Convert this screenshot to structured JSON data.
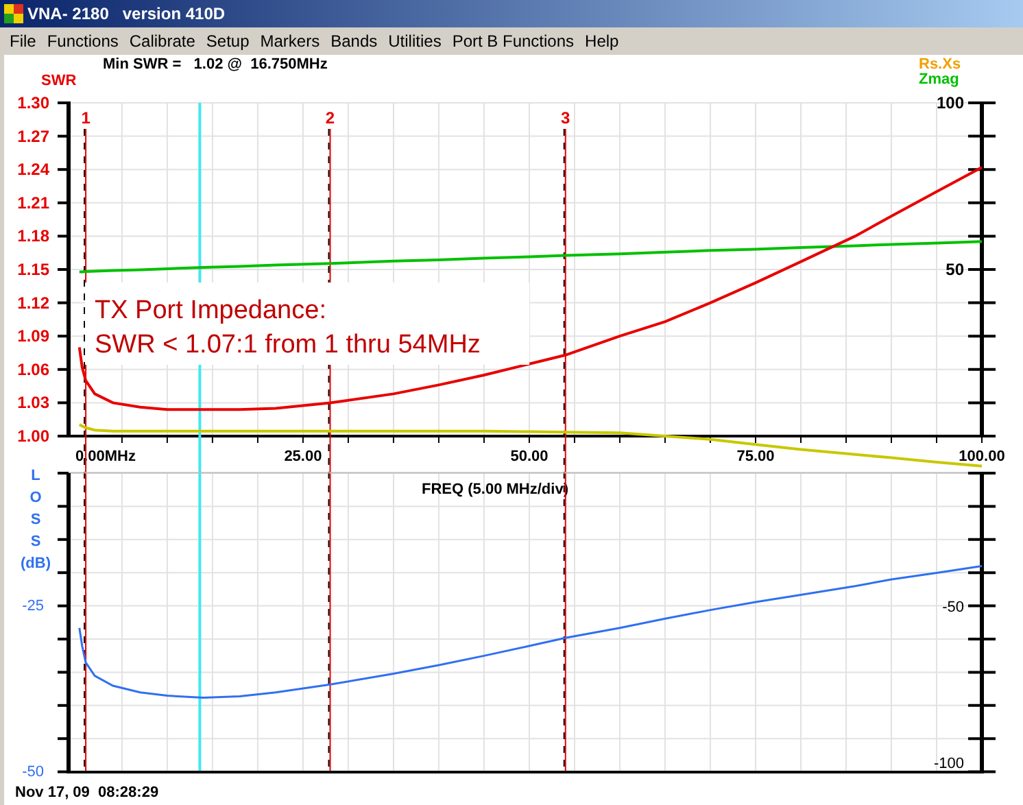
{
  "window": {
    "title": "VNA- 2180   version 410D"
  },
  "menu": [
    "File",
    "Functions",
    "Calibrate",
    "Setup",
    "Markers",
    "Bands",
    "Utilities",
    "Port B Functions",
    "Help"
  ],
  "readout": "Min SWR =   1.02 @  16.750MHz",
  "swr_chart": {
    "chart_data": {
      "type": "line",
      "xlabel": "FREQ (5.00 MHz/div)",
      "x": [
        0.3,
        0.6,
        1,
        2,
        4,
        7,
        10,
        14,
        18,
        22,
        28,
        35,
        40,
        45,
        50,
        54,
        60,
        65,
        70,
        75,
        80,
        86,
        90,
        95,
        100
      ],
      "series": [
        {
          "name": "SWR",
          "color": "#e80000",
          "values": [
            1.08,
            1.062,
            1.05,
            1.038,
            1.03,
            1.026,
            1.024,
            1.024,
            1.024,
            1.025,
            1.03,
            1.038,
            1.046,
            1.055,
            1.065,
            1.073,
            1.09,
            1.103,
            1.12,
            1.138,
            1.157,
            1.18,
            1.198,
            1.22,
            1.242
          ]
        }
      ],
      "xlim": [
        -0.9,
        100
      ],
      "ylim": [
        1.0,
        1.3
      ],
      "xticks": [
        {
          "value": 0,
          "label": "0.00MHz"
        },
        {
          "value": 25,
          "label": "25.00"
        },
        {
          "value": 50,
          "label": "50.00"
        },
        {
          "value": 75,
          "label": "75.00"
        },
        {
          "value": 100,
          "label": "100.00"
        }
      ],
      "yticks": [
        {
          "value": 1.0,
          "label": "1.00"
        },
        {
          "value": 1.03,
          "label": "1.03"
        },
        {
          "value": 1.06,
          "label": "1.06"
        },
        {
          "value": 1.09,
          "label": "1.09"
        },
        {
          "value": 1.12,
          "label": "1.12"
        },
        {
          "value": 1.15,
          "label": "1.15"
        },
        {
          "value": 1.18,
          "label": "1.18"
        },
        {
          "value": 1.21,
          "label": "1.21"
        },
        {
          "value": 1.24,
          "label": "1.24"
        },
        {
          "value": 1.27,
          "label": "1.27"
        },
        {
          "value": 1.3,
          "label": "1.30"
        }
      ],
      "annotations": [
        {
          "x": 1,
          "text": "1"
        },
        {
          "x": 28,
          "text": "2"
        },
        {
          "x": 54,
          "text": "3"
        }
      ],
      "ref_lines": [
        {
          "axis": "x",
          "value": 13.6
        }
      ]
    }
  },
  "impedance_chart": {
    "chart_data": {
      "type": "line",
      "x": [
        0.3,
        0.6,
        1,
        2,
        4,
        7,
        10,
        14,
        18,
        22,
        28,
        35,
        40,
        45,
        50,
        54,
        60,
        65,
        70,
        75,
        80,
        86,
        90,
        95,
        100
      ],
      "series": [
        {
          "name": "Rs.Xs",
          "color": "#c8c800",
          "values": [
            3.5,
            3,
            2.5,
            1.8,
            1.5,
            1.5,
            1.5,
            1.5,
            1.5,
            1.5,
            1.5,
            1.5,
            1.5,
            1.5,
            1.3,
            1.2,
            1,
            0,
            -1,
            -2.5,
            -4,
            -5.5,
            -6.5,
            -7.8,
            -9
          ]
        },
        {
          "name": "Zmag",
          "color": "#00c000",
          "values": [
            49.3,
            49.3,
            49.4,
            49.5,
            49.7,
            49.9,
            50.2,
            50.6,
            50.9,
            51.3,
            51.8,
            52.5,
            52.9,
            53.4,
            53.8,
            54.2,
            54.7,
            55.2,
            55.7,
            56.1,
            56.6,
            57.1,
            57.5,
            57.9,
            58.4
          ]
        }
      ],
      "xlim": [
        -0.9,
        100
      ],
      "ylim": [
        -11,
        100
      ],
      "yticks": [
        {
          "value": 50,
          "label": "50"
        },
        {
          "value": 100,
          "label": "100"
        }
      ]
    }
  },
  "note": [
    "TX Port Impedance:",
    "SWR < 1.07:1 from 1 thru 54MHz"
  ],
  "loss_chart": {
    "axis_unit": "(dB)",
    "chart_data": {
      "type": "line",
      "x": [
        0.3,
        0.6,
        1,
        2,
        4,
        7,
        10,
        14,
        18,
        22,
        28,
        35,
        40,
        45,
        50,
        54,
        60,
        65,
        70,
        75,
        80,
        86,
        90,
        95,
        100
      ],
      "series": [
        {
          "name": "LOSS",
          "color": "#3070f0",
          "values": [
            -28.3,
            -31,
            -33.5,
            -35.5,
            -37,
            -38,
            -38.5,
            -38.8,
            -38.6,
            -38,
            -36.8,
            -35.2,
            -33.9,
            -32.5,
            -31,
            -29.8,
            -28.3,
            -26.9,
            -25.6,
            -24.4,
            -23.3,
            -22,
            -21,
            -20,
            -19
          ]
        }
      ],
      "xlim": [
        -0.9,
        100
      ],
      "ylim": [
        -50,
        -5
      ],
      "yticks": [
        {
          "value": -25,
          "label": "-25"
        },
        {
          "value": -50,
          "label": "-50"
        }
      ]
    },
    "right_ticks": [
      "-50",
      "-100"
    ]
  },
  "timestamp": "Nov 17, 09  08:28:29"
}
